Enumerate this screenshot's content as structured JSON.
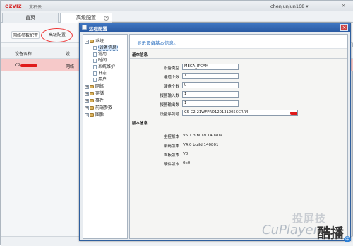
{
  "app": {
    "logo": "ezviz",
    "logo_cn": "萤石云",
    "user": "chenjunjun168 ▾",
    "minimize": "–",
    "close": "×"
  },
  "tabs": [
    {
      "label": "首页"
    },
    {
      "label": "高级配置"
    }
  ],
  "toolbar": {
    "network_params_label": "网络参数配置",
    "advanced_config_label": "高级配置"
  },
  "device_list": {
    "headers": [
      "设备名称",
      "设"
    ],
    "rows": [
      {
        "name_prefix": "C2",
        "col2_prefix": "网络"
      }
    ]
  },
  "dialog": {
    "title": "远程配置",
    "close": "×",
    "hint": "显示设备基本信息。",
    "tree": [
      {
        "label": "系统",
        "expander": "-",
        "level": 0
      },
      {
        "label": "设备信息",
        "level": 1,
        "selected": true
      },
      {
        "label": "常用",
        "level": 1
      },
      {
        "label": "时间",
        "level": 1
      },
      {
        "label": "系统维护",
        "level": 1
      },
      {
        "label": "日志",
        "level": 1
      },
      {
        "label": "用户",
        "level": 1
      },
      {
        "label": "网络",
        "expander": "+",
        "level": 0
      },
      {
        "label": "存储",
        "expander": "+",
        "level": 0
      },
      {
        "label": "事件",
        "expander": "+",
        "level": 0
      },
      {
        "label": "前端参数",
        "expander": "+",
        "level": 0
      },
      {
        "label": "图像",
        "expander": "+",
        "level": 0
      }
    ],
    "basic_section": "基本信息",
    "basic_fields": [
      {
        "label": "设备类型",
        "value": "MEGA_IPCAM"
      },
      {
        "label": "通道个数",
        "value": "1"
      },
      {
        "label": "硬盘个数",
        "value": "0"
      },
      {
        "label": "报警输入数",
        "value": "1"
      },
      {
        "label": "报警输出数",
        "value": "1"
      },
      {
        "label": "设备序列号",
        "value": "CS-C2-21WFPRD120131205CCRR4"
      }
    ],
    "version_section": "版本信息",
    "version_fields": [
      {
        "label": "主控版本",
        "value": "V5.1.3 build 140909"
      },
      {
        "label": "编码版本",
        "value": "V4.0 build 140801"
      },
      {
        "label": "面板版本",
        "value": "V0"
      },
      {
        "label": "硬件版本",
        "value": "0x0"
      }
    ]
  },
  "watermark": {
    "cn_top": "投屏技",
    "en": "CuPlayer",
    "cn_big": "酷播",
    "badge": "中"
  }
}
